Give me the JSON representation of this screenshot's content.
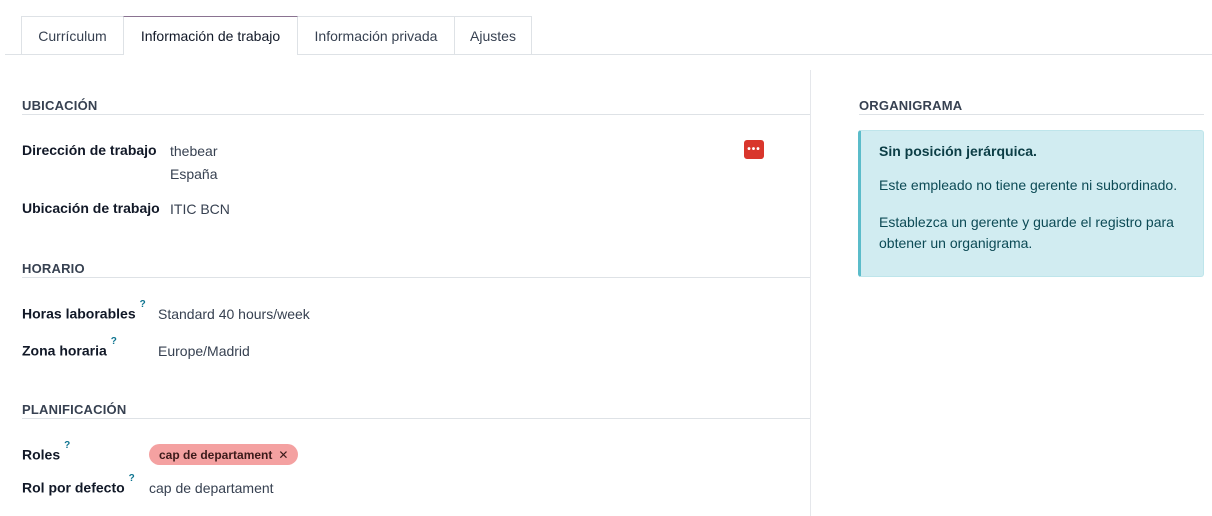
{
  "tabs": [
    {
      "label": "Currículum",
      "active": false
    },
    {
      "label": "Información de trabajo",
      "active": true
    },
    {
      "label": "Información privada",
      "active": false
    },
    {
      "label": "Ajustes",
      "active": false
    }
  ],
  "location": {
    "title": "UBICACIÓN",
    "work_address_label": "Dirección de trabajo",
    "work_address_line1": "thebear",
    "work_address_line2": "España",
    "work_location_label": "Ubicación de trabajo",
    "work_location_value": "ITIC BCN",
    "more_icon": "ellipsis-icon"
  },
  "schedule": {
    "title": "HORARIO",
    "working_hours_label": "Horas laborables",
    "working_hours_value": "Standard 40 hours/week",
    "timezone_label": "Zona horaria",
    "timezone_value": "Europe/Madrid",
    "help_mark": "?"
  },
  "planning": {
    "title": "PLANIFICACIÓN",
    "roles_label": "Roles",
    "roles_tags": [
      "cap de departament"
    ],
    "tag_remove": "✕",
    "default_role_label": "Rol por defecto",
    "default_role_value": "cap de departament"
  },
  "orgchart": {
    "title": "ORGANIGRAMA",
    "alert_title": "Sin posición jerárquica.",
    "alert_line1": "Este empleado no tiene gerente ni subordinado.",
    "alert_line2": "Establezca un gerente y guarde el registro para obtener un organigrama."
  },
  "colors": {
    "accent": "#8a7391",
    "more_button": "#d9362c",
    "tag_bg": "#f4a1a1",
    "alert_bg": "#d1ecf1",
    "help": "#0e7490"
  }
}
